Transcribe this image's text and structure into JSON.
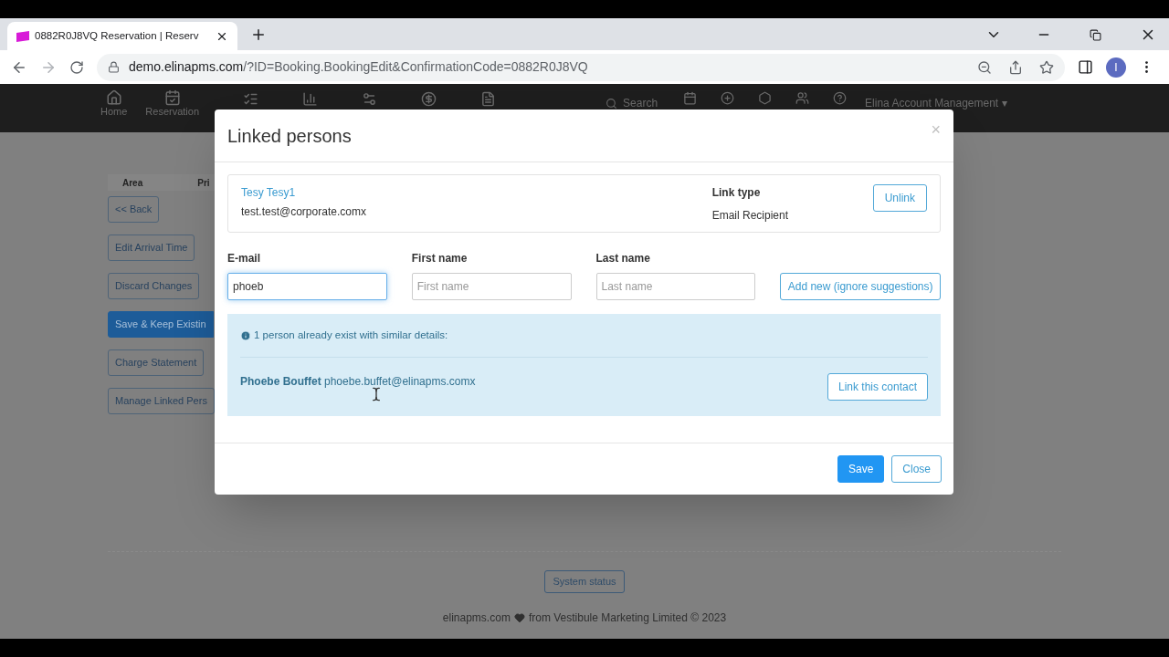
{
  "browser": {
    "tab_title": "0882R0J8VQ Reservation | Reserv",
    "url_host": "demo.elinapms.com",
    "url_path": "/?ID=Booking.BookingEdit&ConfirmationCode=0882R0J8VQ",
    "profile": "I"
  },
  "nav": {
    "items": [
      {
        "label": "Home"
      },
      {
        "label": "Reservation"
      }
    ],
    "search_placeholder": "Search",
    "account": "Elina Account Management",
    "account_caret": "▾"
  },
  "page": {
    "table_headers": [
      "Area",
      "Pri"
    ],
    "buttons": [
      {
        "label": "<< Back",
        "kind": "outline"
      },
      {
        "label": "Edit Arrival Time",
        "kind": "outline"
      },
      {
        "label": "Discard Changes",
        "kind": "outline"
      },
      {
        "label": "Save & Keep Existin",
        "kind": "primary"
      },
      {
        "label": "Charge Statement",
        "kind": "outline"
      },
      {
        "label": "Manage Linked Pers",
        "kind": "outline"
      }
    ],
    "system_status": "System status",
    "footer_site": "elinapms.com",
    "footer_rest": "from Vestibule Marketing Limited © 2023"
  },
  "modal": {
    "title": "Linked persons",
    "close": "×",
    "linked": {
      "name": "Tesy Tesy1",
      "email": "test.test@corporate.comx",
      "link_type_label": "Link type",
      "link_type": "Email Recipient",
      "unlink": "Unlink"
    },
    "fields": [
      {
        "label": "E-mail",
        "value": "phoeb",
        "focused": true
      },
      {
        "label": "First name",
        "placeholder": "First name",
        "focused": false
      },
      {
        "label": "Last name",
        "placeholder": "Last name",
        "focused": false
      }
    ],
    "add_button": "Add new (ignore suggestions)",
    "notice": "1 person already exist with similar details:",
    "suggestion": {
      "name": "Phoebe Bouffet",
      "email": "phoebe.buffet@elinapms.comx",
      "button": "Link this contact"
    },
    "buttons": [
      {
        "label": "Save",
        "kind": "primary"
      },
      {
        "label": "Close",
        "kind": "outline"
      }
    ]
  }
}
